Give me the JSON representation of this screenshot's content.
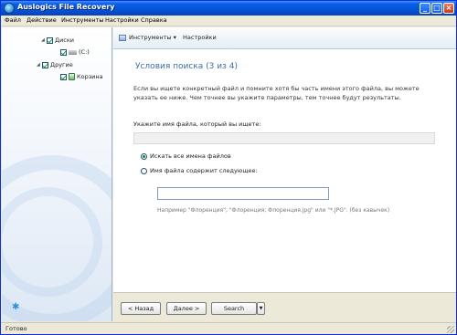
{
  "window": {
    "title": "Auslogics File Recovery"
  },
  "menu": [
    "Файл",
    "Действие",
    "Инструменты",
    "Настройки",
    "Справка"
  ],
  "tree": {
    "disks": "Диски",
    "drive_c": "(C:)",
    "other": "Другие",
    "recycle_bin": "Корзина"
  },
  "toolbar": {
    "tools": "Инструменты ▾",
    "settings": "Настройки"
  },
  "content": {
    "title": "Условия поиска (3 из 4)",
    "description": "Если вы ищете конкретный файл и помните хотя бы часть имени этого файла, вы можете указать ее ниже. Чем точнее вы укажите параметры, тем точнее будут результаты.",
    "field_label": "Укажите имя файла, который вы ищете:",
    "option_all": "Искать все имена файлов",
    "option_contains": "Имя файла содержит следующее:",
    "filename_value": "",
    "example": "Например \"Флоренция\", \"Флоренция; Флоренция.jpg\" или \"*.JPG\". (без кавычек)"
  },
  "nav": {
    "back": "< Назад",
    "next": "Далее >",
    "search": "Search"
  },
  "status": {
    "text": "Готово"
  }
}
